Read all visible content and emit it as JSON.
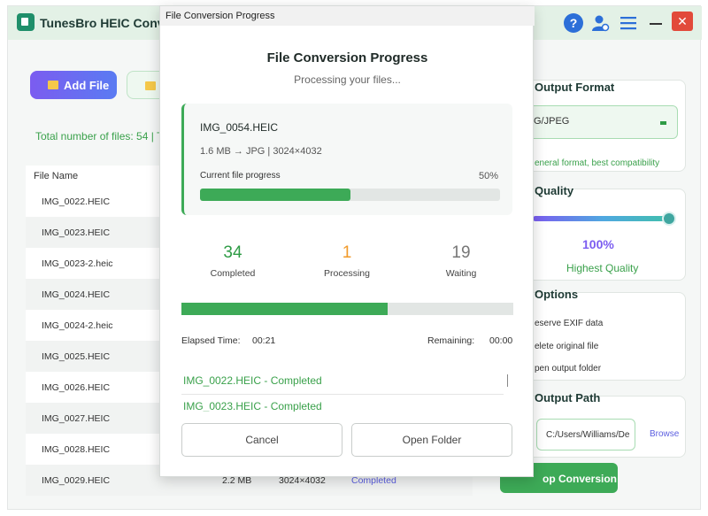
{
  "app": {
    "title": "TunesBro HEIC Converter",
    "toolbar": {
      "add_file": "Add File"
    },
    "total_files": "Total number of files: 54 | To",
    "file_list": {
      "header": "File Name",
      "rows": [
        {
          "name": "IMG_0022.HEIC",
          "size": "",
          "resolution": "",
          "status": ""
        },
        {
          "name": "IMG_0023.HEIC",
          "size": "",
          "resolution": "",
          "status": ""
        },
        {
          "name": "IMG_0023-2.heic",
          "size": "",
          "resolution": "",
          "status": ""
        },
        {
          "name": "IMG_0024.HEIC",
          "size": "",
          "resolution": "",
          "status": ""
        },
        {
          "name": "IMG_0024-2.heic",
          "size": "",
          "resolution": "",
          "status": ""
        },
        {
          "name": "IMG_0025.HEIC",
          "size": "",
          "resolution": "",
          "status": ""
        },
        {
          "name": "IMG_0026.HEIC",
          "size": "",
          "resolution": "",
          "status": ""
        },
        {
          "name": "IMG_0027.HEIC",
          "size": "",
          "resolution": "",
          "status": ""
        },
        {
          "name": "IMG_0028.HEIC",
          "size": "",
          "resolution": "",
          "status": ""
        },
        {
          "name": "IMG_0029.HEIC",
          "size": "2.2 MB",
          "resolution": "3024×4032",
          "status": "Completed"
        }
      ]
    },
    "output_format": {
      "title": "Output Format",
      "value": "G/JPEG",
      "description": "eneral format, best compatibility"
    },
    "quality": {
      "title": "Quality",
      "value": "100%",
      "level": 1.0,
      "label": "Highest Quality"
    },
    "options": {
      "title": "Options",
      "items": [
        "eserve EXIF data",
        "elete original file",
        "pen output folder"
      ]
    },
    "output_path": {
      "title": "Output Path",
      "value": "C:/Users/Williams/De",
      "browse": "Browse"
    },
    "start_button": "op Conversion"
  },
  "modal": {
    "window_title": "File Conversion Progress",
    "title": "File Conversion Progress",
    "subtitle": "Processing your files...",
    "current": {
      "file": "IMG_0054.HEIC",
      "meta": "1.6 MB → JPG | 3024×4032",
      "label": "Current file progress",
      "percent_text": "50%",
      "progress": 0.5
    },
    "stats": {
      "completed": {
        "value": "34",
        "label": "Completed"
      },
      "processing": {
        "value": "1",
        "label": "Processing"
      },
      "waiting": {
        "value": "19",
        "label": "Waiting"
      }
    },
    "overall_progress": 0.62,
    "elapsed_label": "Elapsed Time:",
    "elapsed_value": "00:21",
    "remaining_label": "Remaining:",
    "remaining_value": "00:00",
    "log": [
      "IMG_0022.HEIC - Completed",
      "IMG_0023.HEIC - Completed"
    ],
    "buttons": {
      "cancel": "Cancel",
      "open_folder": "Open Folder"
    }
  },
  "colors": {
    "accent_green": "#3daa57",
    "accent_purple": "#7b5cf0",
    "processing_orange": "#f19a2a"
  },
  "icons": [
    "help-icon",
    "user-icon",
    "menu-icon",
    "minimize-icon",
    "close-icon",
    "folder-icon"
  ]
}
